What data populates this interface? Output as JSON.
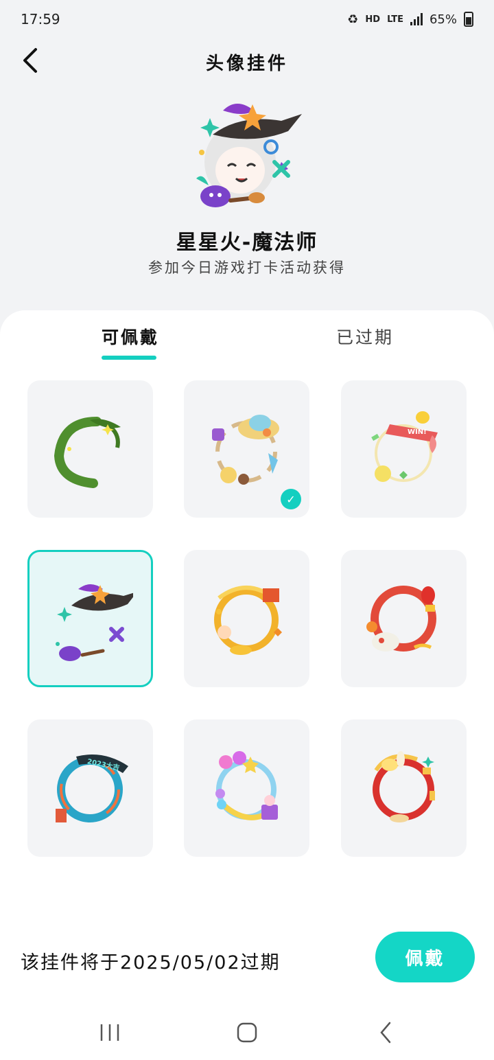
{
  "status_bar": {
    "time": "17:59",
    "network_hd": "HD",
    "network_lte": "LTE",
    "battery_percent": "65%",
    "icons": [
      "recycle-icon",
      "signal-icon",
      "battery-icon"
    ]
  },
  "header": {
    "title": "头像挂件",
    "back_icon": "chevron-left-icon"
  },
  "preview": {
    "name": "星星火-魔法师",
    "description": "参加今日游戏打卡活动获得"
  },
  "tabs": [
    {
      "label": "可佩戴",
      "active": true
    },
    {
      "label": "已过期",
      "active": false
    }
  ],
  "grid": {
    "items": [
      {
        "name": "bamboo-leaf-frame",
        "equipped": false,
        "selected": false
      },
      {
        "name": "summer-hat-frame",
        "equipped": true,
        "selected": false
      },
      {
        "name": "win-ribbon-frame",
        "equipped": false,
        "selected": false
      },
      {
        "name": "witch-hat-frame",
        "equipped": false,
        "selected": true
      },
      {
        "name": "gold-ribbon-frame",
        "equipped": false,
        "selected": false
      },
      {
        "name": "lion-dance-frame",
        "equipped": false,
        "selected": false
      },
      {
        "name": "2023-year-frame",
        "equipped": false,
        "selected": false
      },
      {
        "name": "balloon-frame",
        "equipped": false,
        "selected": false
      },
      {
        "name": "red-bunny-frame",
        "equipped": false,
        "selected": false
      }
    ]
  },
  "footer": {
    "expiry_text": "该挂件将于2025/05/02过期",
    "wear_button": "佩戴"
  },
  "colors": {
    "accent": "#14cfc0",
    "button": "#14d6c6",
    "card_bg": "#f3f4f6",
    "page_bg": "#f2f3f5"
  }
}
